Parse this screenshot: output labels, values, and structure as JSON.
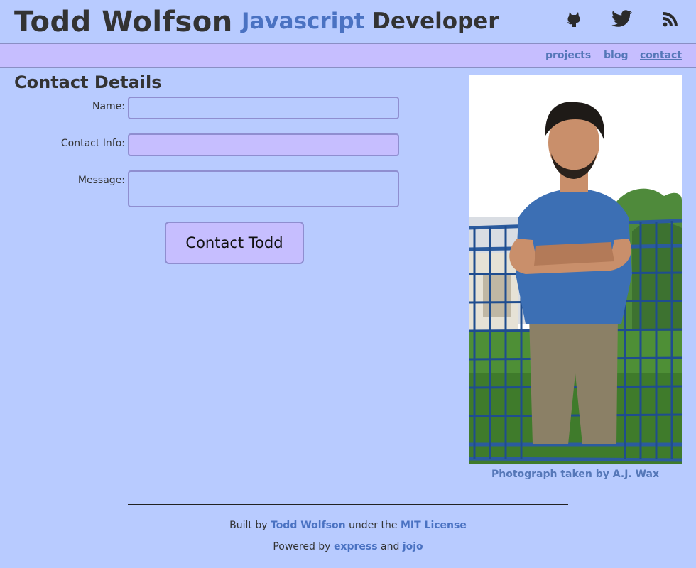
{
  "header": {
    "name": "Todd Wolfson",
    "tagline_accent": "Javascript",
    "tagline_rest": "Developer",
    "social": [
      {
        "icon": "github-icon"
      },
      {
        "icon": "twitter-icon"
      },
      {
        "icon": "rss-icon"
      }
    ]
  },
  "nav": {
    "items": [
      {
        "label": "projects"
      },
      {
        "label": "blog"
      },
      {
        "label": "contact",
        "active": true
      }
    ]
  },
  "contact": {
    "title": "Contact Details",
    "name_label": "Name:",
    "name_value": "",
    "info_label": "Contact Info:",
    "info_value": "",
    "message_label": "Message:",
    "message_value": "",
    "submit_label": "Contact Todd"
  },
  "photo": {
    "caption": "Photograph taken by A.J. Wax"
  },
  "footer": {
    "built_prefix": "Built by",
    "built_author": "Todd Wolfson",
    "built_middle": "under the",
    "built_license": "MIT License",
    "powered_prefix": "Powered by",
    "powered_first": "express",
    "powered_and": "and",
    "powered_second": "jojo"
  },
  "colors": {
    "background": "#b8cbff",
    "navbar": "#c6beff",
    "accent": "#4a72c2",
    "link": "#5577b8",
    "text": "#333333"
  }
}
